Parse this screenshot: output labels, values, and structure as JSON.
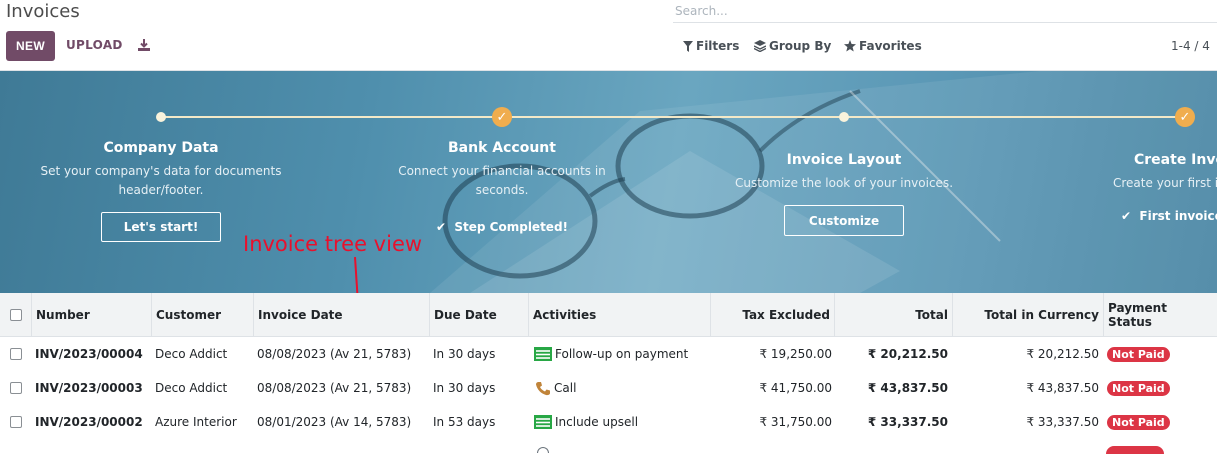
{
  "control_panel": {
    "title": "Invoices",
    "new_label": "NEW",
    "upload_label": "UPLOAD",
    "search_placeholder": "Search...",
    "filters_label": "Filters",
    "groupby_label": "Group By",
    "favorites_label": "Favorites",
    "pager": "1-4 / 4"
  },
  "onboarding": {
    "steps": [
      {
        "title": "Company Data",
        "desc_line1": "Set your company's data for documents",
        "desc_line2": "header/footer.",
        "button": "Let's start!"
      },
      {
        "title": "Bank Account",
        "desc_line1": "Connect your financial accounts in",
        "desc_line2": "seconds.",
        "done": "Step Completed!"
      },
      {
        "title": "Invoice Layout",
        "desc_line1": "Customize the look of your invoices.",
        "button": "Customize"
      },
      {
        "title": "Create Invo",
        "desc_line1": "Create your first i",
        "done": "First invoice"
      }
    ]
  },
  "annotation": "Invoice tree view",
  "table": {
    "headers": [
      "Number",
      "Customer",
      "Invoice Date",
      "Due Date",
      "Activities",
      "Tax Excluded",
      "Total",
      "Total in Currency",
      "Payment Status"
    ],
    "rows": [
      {
        "number": "INV/2023/00004",
        "customer": "Deco Addict",
        "invoice_date": "08/08/2023 (Av 21, 5783)",
        "due_date": "In 30 days",
        "activity_icon": "envelope-list-icon",
        "activity": "Follow-up on payment",
        "tax_excluded": "₹ 19,250.00",
        "total": "₹ 20,212.50",
        "total_currency": "₹ 20,212.50",
        "status": "Not Paid"
      },
      {
        "number": "INV/2023/00003",
        "customer": "Deco Addict",
        "invoice_date": "08/08/2023 (Av 21, 5783)",
        "due_date": "In 30 days",
        "activity_icon": "phone-icon",
        "activity": "Call",
        "tax_excluded": "₹ 41,750.00",
        "total": "₹ 43,837.50",
        "total_currency": "₹ 43,837.50",
        "status": "Not Paid"
      },
      {
        "number": "INV/2023/00002",
        "customer": "Azure Interior",
        "invoice_date": "08/01/2023 (Av 14, 5783)",
        "due_date": "In 53 days",
        "activity_icon": "envelope-list-icon",
        "activity": "Include upsell",
        "tax_excluded": "₹ 31,750.00",
        "total": "₹ 33,337.50",
        "total_currency": "₹ 33,337.50",
        "status": "Not Paid"
      }
    ]
  },
  "colors": {
    "brand": "#714b67",
    "status_not_paid": "#dc3545",
    "activity_green": "#28a745",
    "activity_phone": "#c0843a",
    "step_done": "#f0ad4e",
    "annotation": "#e8112d"
  }
}
